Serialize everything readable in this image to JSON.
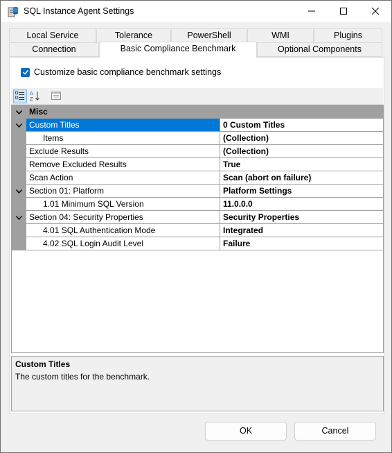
{
  "window": {
    "title": "SQL Instance Agent Settings"
  },
  "tabs": {
    "row1": [
      {
        "label": "Local Service"
      },
      {
        "label": "Tolerance"
      },
      {
        "label": "PowerShell"
      },
      {
        "label": "WMI"
      },
      {
        "label": "Plugins"
      }
    ],
    "row2": [
      {
        "label": "Connection"
      },
      {
        "label": "Basic Compliance Benchmark",
        "selected": true
      },
      {
        "label": "Optional Components"
      }
    ]
  },
  "options": {
    "customize_label": "Customize basic compliance benchmark settings",
    "customize_checked": true
  },
  "toolbar": {
    "categorized_icon": "categorized-icon",
    "alphabetical_icon": "alphabetical-icon",
    "property_pages_icon": "property-pages-icon"
  },
  "grid": {
    "category": "Misc",
    "rows": [
      {
        "name": "Custom Titles",
        "value": "0 Custom Titles",
        "expandable": true,
        "selected": true
      },
      {
        "name": "Items",
        "value": "(Collection)",
        "indent": true
      },
      {
        "name": "Exclude Results",
        "value": "(Collection)"
      },
      {
        "name": "Remove Excluded Results",
        "value": "True"
      },
      {
        "name": "Scan Action",
        "value": "Scan (abort on failure)"
      },
      {
        "name": "Section 01: Platform",
        "value": "Platform Settings",
        "expandable": true
      },
      {
        "name": "1.01 Minimum SQL Version",
        "value": "11.0.0.0",
        "indent": true
      },
      {
        "name": "Section 04: Security Properties",
        "value": "Security Properties",
        "expandable": true
      },
      {
        "name": "4.01 SQL Authentication Mode",
        "value": "Integrated",
        "indent": true
      },
      {
        "name": "4.02 SQL Login Audit Level",
        "value": "Failure",
        "indent": true
      }
    ]
  },
  "description": {
    "title": "Custom Titles",
    "text": "The custom titles for the benchmark."
  },
  "buttons": {
    "ok": "OK",
    "cancel": "Cancel"
  },
  "colors": {
    "accent": "#0078d7",
    "checkbox": "#0f6cbd",
    "gutter": "#a0a0a0"
  }
}
